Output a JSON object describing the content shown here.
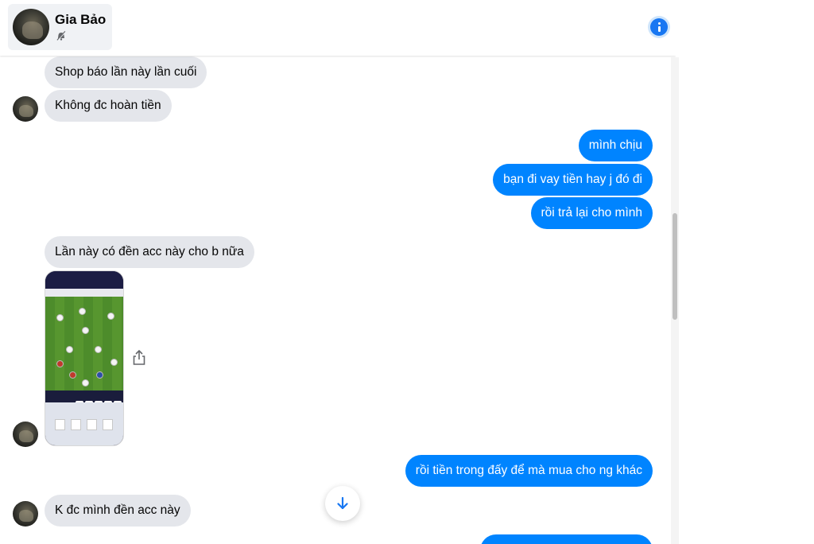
{
  "header": {
    "contact_name": "Gia Bảo",
    "mute_icon": "muted-bell-icon",
    "info_icon": "info-icon",
    "accent_color": "#1877f2"
  },
  "messages": [
    {
      "direction": "in",
      "text": "Shop báo lần này lần cuối"
    },
    {
      "direction": "in",
      "text": "Không đc hoàn tiền"
    },
    {
      "direction": "out",
      "text": "mình chịu"
    },
    {
      "direction": "out",
      "text": "bạn đi vay tiền hay j đó đi"
    },
    {
      "direction": "out",
      "text": "rồi trả lại cho mình"
    },
    {
      "direction": "in",
      "text": "Lần này có đền acc này cho b nữa"
    },
    {
      "direction": "in",
      "type": "image",
      "description_icon": "game-screenshot"
    },
    {
      "direction": "out",
      "text": "rồi tiền trong đấy để mà mua cho ng khác"
    },
    {
      "direction": "in",
      "text": "K đc mình đền acc này"
    }
  ],
  "colors": {
    "incoming_bubble": "#e4e6eb",
    "outgoing_bubble": "#0084ff",
    "incoming_text": "#050505",
    "outgoing_text": "#ffffff"
  },
  "controls": {
    "share_icon": "share-icon",
    "scroll_down_icon": "arrow-down-icon"
  }
}
